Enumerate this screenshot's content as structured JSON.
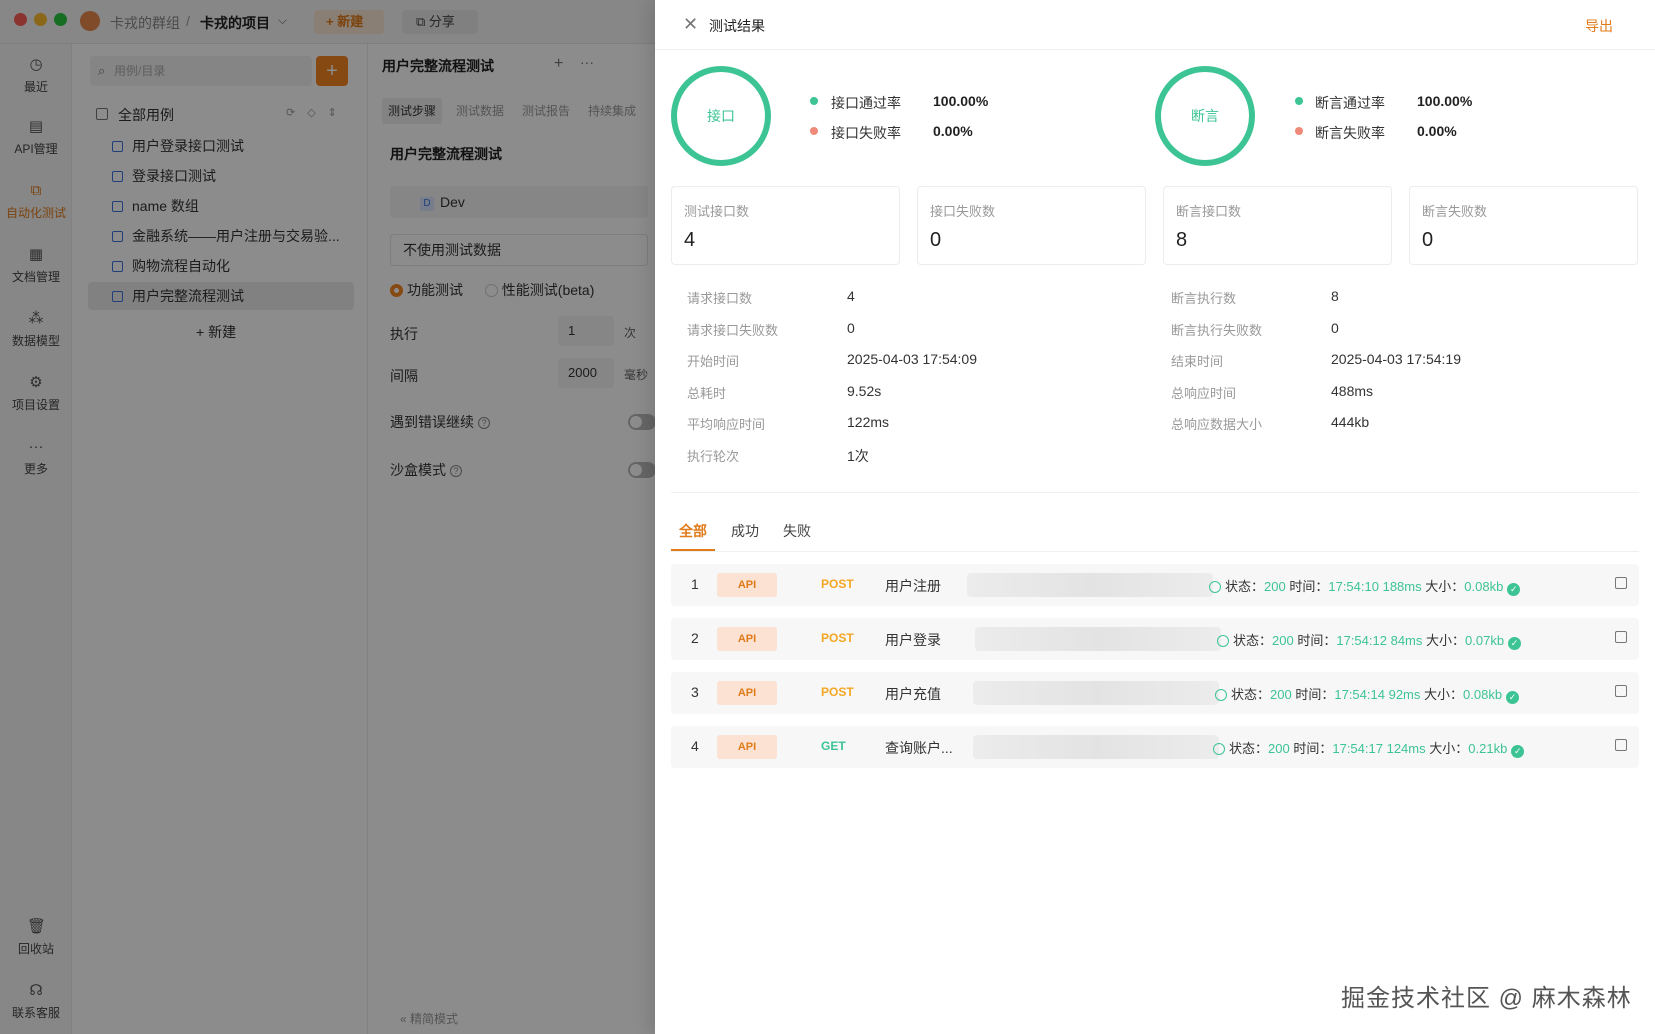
{
  "app": {
    "breadcrumb": {
      "group": "卡戎的群组",
      "separator": "/",
      "project": "卡戎的项目",
      "chevron": "⌵"
    },
    "toolbar": {
      "new_label": "+ 新建",
      "share_label": "⧉ 分享"
    },
    "nav": [
      {
        "label": "最近",
        "icon": "clock-icon"
      },
      {
        "label": "API管理",
        "icon": "api-icon"
      },
      {
        "label": "自动化测试",
        "icon": "automation-icon"
      },
      {
        "label": "文档管理",
        "icon": "document-icon"
      },
      {
        "label": "数据模型",
        "icon": "data-model-icon"
      },
      {
        "label": "项目设置",
        "icon": "settings-icon"
      },
      {
        "label": "更多",
        "icon": "more-icon"
      },
      {
        "label": "回收站",
        "icon": "trash-icon"
      },
      {
        "label": "联系客服",
        "icon": "headset-icon"
      }
    ],
    "tree": {
      "search_placeholder": "用例/目录",
      "add": "+",
      "root": "全部用例",
      "items": [
        "用户登录接口测试",
        "登录接口测试",
        "name 数组",
        "金融系统——用户注册与交易验...",
        "购物流程自动化",
        "用户完整流程测试"
      ],
      "new_label": "+ 新建"
    },
    "content": {
      "tab_title": "用户完整流程测试",
      "tab_plus": "+",
      "tab_more": "···",
      "subtabs": [
        "测试步骤",
        "测试数据",
        "测试报告",
        "持续集成"
      ],
      "heading": "用户完整流程测试",
      "env_badge": "D",
      "env": "Dev",
      "data_select": "不使用测试数据",
      "mode_functional": "功能测试",
      "mode_perf": "性能测试(beta)",
      "exec_label": "执行",
      "exec_value": "1",
      "exec_unit": "次",
      "interval_label": "间隔",
      "interval_value": "2000",
      "interval_unit": "毫秒",
      "continue_on_error": "遇到错误继续",
      "sandbox": "沙盒模式",
      "simple_mode": "« 精简模式"
    }
  },
  "drawer": {
    "close": "✕",
    "title": "测试结果",
    "export": "导出",
    "interface_ring": "接口",
    "assert_ring": "断言",
    "interface_pass_label": "接口通过率",
    "interface_pass": "100.00%",
    "interface_fail_label": "接口失败率",
    "interface_fail": "0.00%",
    "assert_pass_label": "断言通过率",
    "assert_pass": "100.00%",
    "assert_fail_label": "断言失败率",
    "assert_fail": "0.00%",
    "cards": [
      {
        "label": "测试接口数",
        "value": "4"
      },
      {
        "label": "接口失败数",
        "value": "0"
      },
      {
        "label": "断言接口数",
        "value": "8"
      },
      {
        "label": "断言失败数",
        "value": "0"
      }
    ],
    "left_kv": [
      {
        "label": "请求接口数",
        "value": "4"
      },
      {
        "label": "请求接口失败数",
        "value": "0"
      },
      {
        "label": "开始时间",
        "value": "2025-04-03 17:54:09"
      },
      {
        "label": "总耗时",
        "value": "9.52s"
      },
      {
        "label": "平均响应时间",
        "value": "122ms"
      },
      {
        "label": "执行轮次",
        "value": "1次"
      }
    ],
    "right_kv": [
      {
        "label": "断言执行数",
        "value": "8"
      },
      {
        "label": "断言执行失败数",
        "value": "0"
      },
      {
        "label": "结束时间",
        "value": "2025-04-03 17:54:19"
      },
      {
        "label": "总响应时间",
        "value": "488ms"
      },
      {
        "label": "总响应数据大小",
        "value": "444kb"
      }
    ],
    "result_tabs": [
      "全部",
      "成功",
      "失败"
    ],
    "status_prefix": "状态：",
    "time_prefix": "时间：",
    "size_prefix": "大小：",
    "rows": [
      {
        "num": "1",
        "badge": "API",
        "method": "POST",
        "name": "用户注册",
        "status": "200",
        "time": "17:54:10",
        "duration": "188ms",
        "size": "0.08kb"
      },
      {
        "num": "2",
        "badge": "API",
        "method": "POST",
        "name": "用户登录",
        "status": "200",
        "time": "17:54:12",
        "duration": "84ms",
        "size": "0.07kb"
      },
      {
        "num": "3",
        "badge": "API",
        "method": "POST",
        "name": "用户充值",
        "status": "200",
        "time": "17:54:14",
        "duration": "92ms",
        "size": "0.08kb"
      },
      {
        "num": "4",
        "badge": "API",
        "method": "GET",
        "name": "查询账户...",
        "status": "200",
        "time": "17:54:17",
        "duration": "124ms",
        "size": "0.21kb"
      }
    ]
  },
  "watermark": "掘金技术社区 @ 麻木森林"
}
